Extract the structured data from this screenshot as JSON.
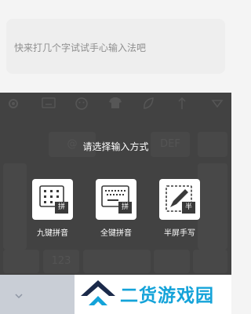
{
  "input": {
    "placeholder": "快来打几个字试试手心输入法吧"
  },
  "toolbar": {
    "items": [
      "settings-icon",
      "keyboard-icon",
      "emoji-icon",
      "skin-icon",
      "leaf-icon",
      "cursor-icon",
      "hide-keyboard-icon"
    ]
  },
  "keyboard_bg": {
    "def_label": "DEF",
    "num_label": "123"
  },
  "dialog": {
    "title": "请选择输入方式",
    "options": [
      {
        "label": "九键拼音",
        "badge": "拼"
      },
      {
        "label": "全键拼音",
        "badge": "拼"
      },
      {
        "label": "半屏手写",
        "badge": "半"
      }
    ]
  },
  "watermark": {
    "text": "二货游戏园"
  },
  "colors": {
    "keyboard_bg": "#505050",
    "watermark_blue": "#14a3d9",
    "logo_dark": "#1b2a4a"
  }
}
